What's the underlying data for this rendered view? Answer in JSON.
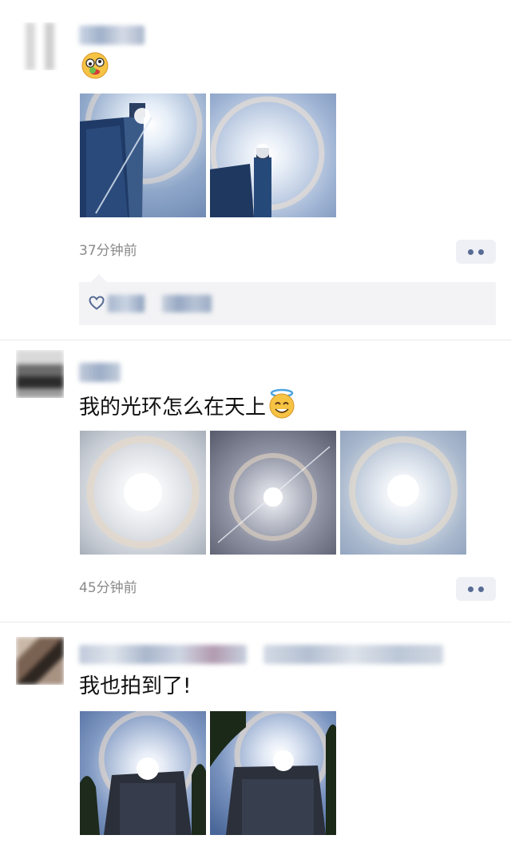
{
  "posts": [
    {
      "text": "",
      "emoji": "zany-face-emoji",
      "time": "37分钟前",
      "photos": [
        "tower-halo-photo",
        "tower-halo-photo"
      ],
      "has_likes": true
    },
    {
      "text": "我的光环怎么在天上",
      "emoji": "smiling-face-with-halo-emoji",
      "time": "45分钟前",
      "photos": [
        "sun-halo-photo",
        "sun-halo-photo",
        "sun-halo-photo"
      ]
    },
    {
      "text": "我也拍到了!",
      "photos": [
        "building-halo-photo",
        "building-halo-photo"
      ]
    }
  ],
  "icons": {
    "more": "more-dots-icon",
    "like": "heart-outline-icon"
  },
  "colors": {
    "link_blue": "#576b95",
    "time_gray": "#8a8a8a",
    "likes_bg": "#f3f3f5"
  }
}
